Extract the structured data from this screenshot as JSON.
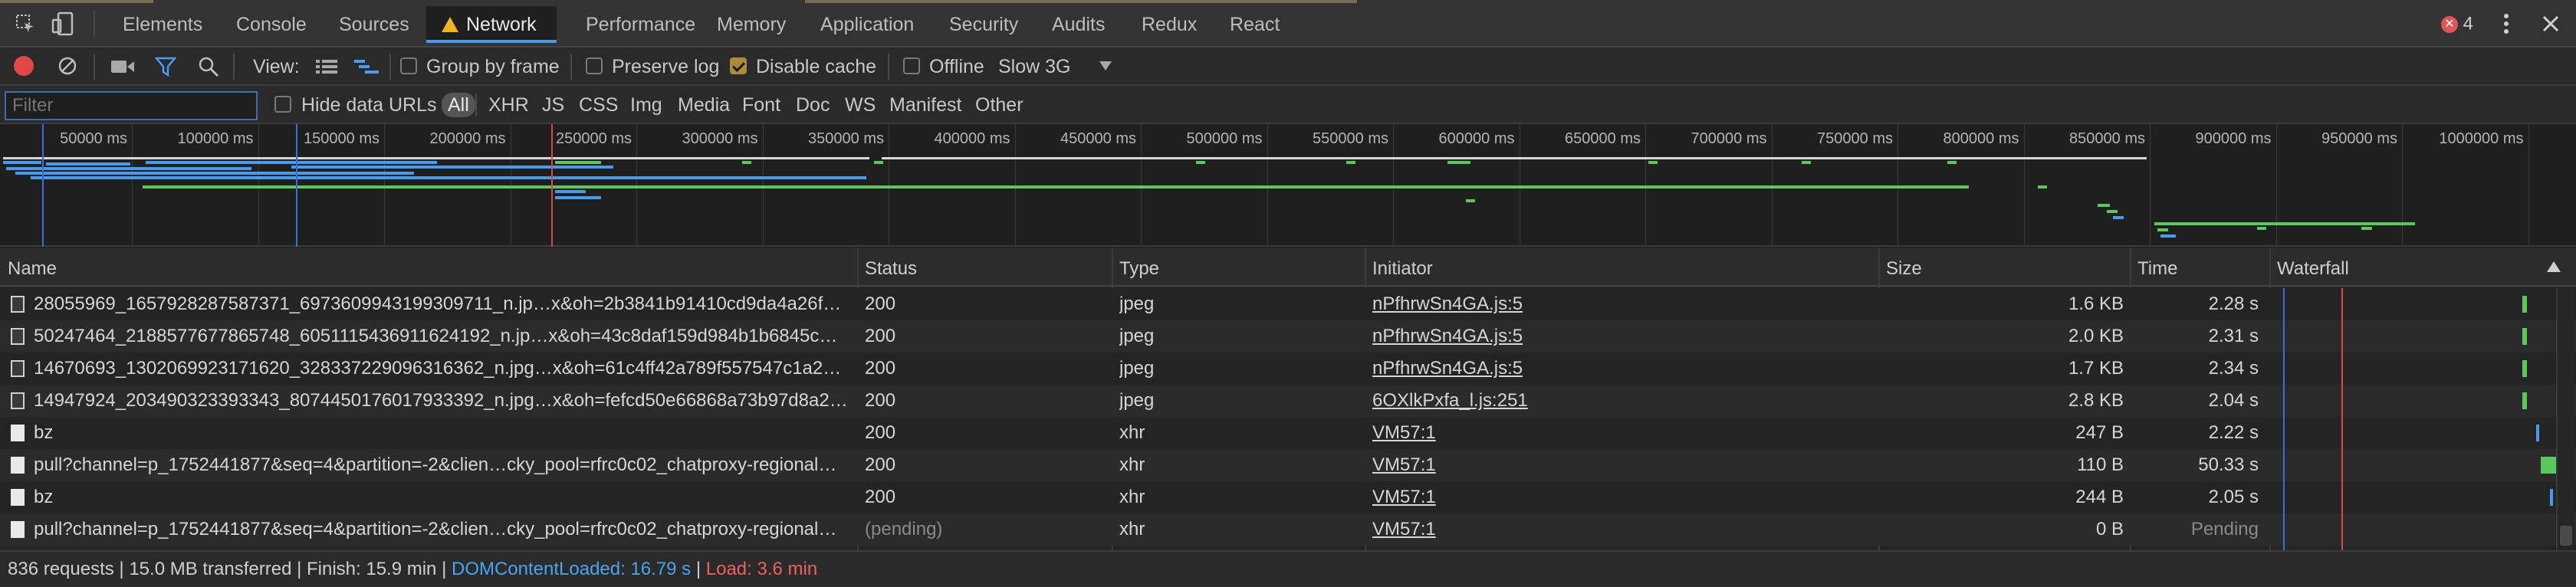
{
  "tabs": [
    {
      "label": "Elements"
    },
    {
      "label": "Console"
    },
    {
      "label": "Sources"
    },
    {
      "label": "Network"
    },
    {
      "label": "Performance"
    },
    {
      "label": "Memory"
    },
    {
      "label": "Application"
    },
    {
      "label": "Security"
    },
    {
      "label": "Audits"
    },
    {
      "label": "Redux"
    },
    {
      "label": "React"
    }
  ],
  "errors": {
    "count": "4",
    "icon": "error-circle-icon"
  },
  "toolbar": {
    "view_label": "View:",
    "group_by_frame": "Group by frame",
    "preserve_log": "Preserve log",
    "disable_cache": "Disable cache",
    "disable_cache_checked": true,
    "offline": "Offline",
    "throttle": "Slow 3G"
  },
  "filter": {
    "placeholder": "Filter",
    "hide_data_urls": "Hide data URLs",
    "types": [
      "All",
      "XHR",
      "JS",
      "CSS",
      "Img",
      "Media",
      "Font",
      "Doc",
      "WS",
      "Manifest",
      "Other"
    ]
  },
  "overview": {
    "ticks": [
      "50000 ms",
      "100000 ms",
      "150000 ms",
      "200000 ms",
      "250000 ms",
      "300000 ms",
      "350000 ms",
      "400000 ms",
      "450000 ms",
      "500000 ms",
      "550000 ms",
      "600000 ms",
      "650000 ms",
      "700000 ms",
      "750000 ms",
      "800000 ms",
      "850000 ms",
      "900000 ms",
      "950000 ms",
      "1000000 ms"
    ]
  },
  "columns": {
    "name": "Name",
    "status": "Status",
    "type": "Type",
    "initiator": "Initiator",
    "size": "Size",
    "time": "Time",
    "waterfall": "Waterfall"
  },
  "rows": [
    {
      "name": "28055969_1657928287587371_6973609943199309711_n.jp…x&oh=2b3841b91410cd9da4a26f…",
      "status": "200",
      "type": "jpeg",
      "initiator": "nPfhrwSn4GA.js:5",
      "size": "1.6 KB",
      "time": "2.28 s",
      "icon": "image-file-icon"
    },
    {
      "name": "50247464_2188577677865748_6051115436911624192_n.jp…x&oh=43c8daf159d984b1b6845c…",
      "status": "200",
      "type": "jpeg",
      "initiator": "nPfhrwSn4GA.js:5",
      "size": "2.0 KB",
      "time": "2.31 s",
      "icon": "image-file-icon"
    },
    {
      "name": "14670693_1302069923171620_328337229096316362_n.jpg…x&oh=61c4ff42a789f557547c1a2…",
      "status": "200",
      "type": "jpeg",
      "initiator": "nPfhrwSn4GA.js:5",
      "size": "1.7 KB",
      "time": "2.34 s",
      "icon": "image-file-icon"
    },
    {
      "name": "14947924_203490323393343_8074450176017933392_n.jpg…x&oh=fefcd50e66868a73b97d8a2…",
      "status": "200",
      "type": "jpeg",
      "initiator": "6OXlkPxfa_l.js:251",
      "size": "2.8 KB",
      "time": "2.04 s",
      "icon": "image-file-icon"
    },
    {
      "name": "bz",
      "status": "200",
      "type": "xhr",
      "initiator": "VM57:1",
      "size": "247 B",
      "time": "2.22 s",
      "icon": "blank-file-icon"
    },
    {
      "name": "pull?channel=p_1752441877&seq=4&partition=-2&clien…cky_pool=rfrc0c02_chatproxy-regional…",
      "status": "200",
      "type": "xhr",
      "initiator": "VM57:1",
      "size": "110 B",
      "time": "50.33 s",
      "icon": "blank-file-icon"
    },
    {
      "name": "bz",
      "status": "200",
      "type": "xhr",
      "initiator": "VM57:1",
      "size": "244 B",
      "time": "2.05 s",
      "icon": "blank-file-icon"
    },
    {
      "name": "pull?channel=p_1752441877&seq=4&partition=-2&clien…cky_pool=rfrc0c02_chatproxy-regional…",
      "status": "(pending)",
      "type": "xhr",
      "initiator": "VM57:1",
      "size": "0 B",
      "time": "Pending",
      "icon": "blank-file-icon"
    }
  ],
  "status_bar": {
    "summary": "836 requests | 15.0 MB transferred | Finish: 15.9 min |",
    "dcl": "DOMContentLoaded: 16.79 s",
    "sep": "|",
    "load": "Load: 3.6 min"
  },
  "colors": {
    "dcl": "#4aa3f0",
    "load": "#f06060",
    "accent": "#4a9bf0"
  }
}
